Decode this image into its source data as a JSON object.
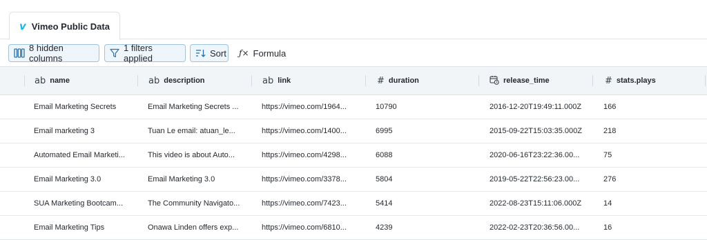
{
  "tab": {
    "label": "Vimeo Public Data",
    "logo_glyph": "v",
    "logo_color": "#1ab7ea"
  },
  "toolbar": {
    "hidden_columns": "8 hidden columns",
    "filters": "1 filters applied",
    "sort": "Sort",
    "formula": "Formula",
    "formula_glyph": "ƒ×"
  },
  "columns": [
    {
      "type_icon": "ab",
      "name": "name"
    },
    {
      "type_icon": "ab",
      "name": "description"
    },
    {
      "type_icon": "ab",
      "name": "link"
    },
    {
      "type_icon": "#",
      "name": "duration"
    },
    {
      "type_icon": "calendar-clock-icon",
      "name": "release_time"
    },
    {
      "type_icon": "#",
      "name": "stats.plays"
    }
  ],
  "rows": [
    [
      "Email Marketing Secrets",
      "Email Marketing Secrets ...",
      "https://vimeo.com/1964...",
      "10790",
      "2016-12-20T19:49:11.000Z",
      "166"
    ],
    [
      "Email marketing 3",
      "Tuan Le email: atuan_le...",
      "https://vimeo.com/1400...",
      "6995",
      "2015-09-22T15:03:35.000Z",
      "218"
    ],
    [
      "Automated Email Marketi...",
      "This video is about Auto...",
      "https://vimeo.com/4298...",
      "6088",
      "2020-06-16T23:22:36.00...",
      "75"
    ],
    [
      "Email Marketing 3.0",
      "Email Marketing 3.0",
      "https://vimeo.com/3378...",
      "5804",
      "2019-05-22T22:56:23.00...",
      "276"
    ],
    [
      "SUA Marketing Bootcam...",
      "The Community Navigato...",
      "https://vimeo.com/7423...",
      "5414",
      "2022-08-23T15:11:06.000Z",
      "14"
    ],
    [
      "Email Marketing Tips",
      "Onawa Linden offers exp...",
      "https://vimeo.com/6810...",
      "4239",
      "2022-02-23T20:36:56.00...",
      "16"
    ]
  ]
}
